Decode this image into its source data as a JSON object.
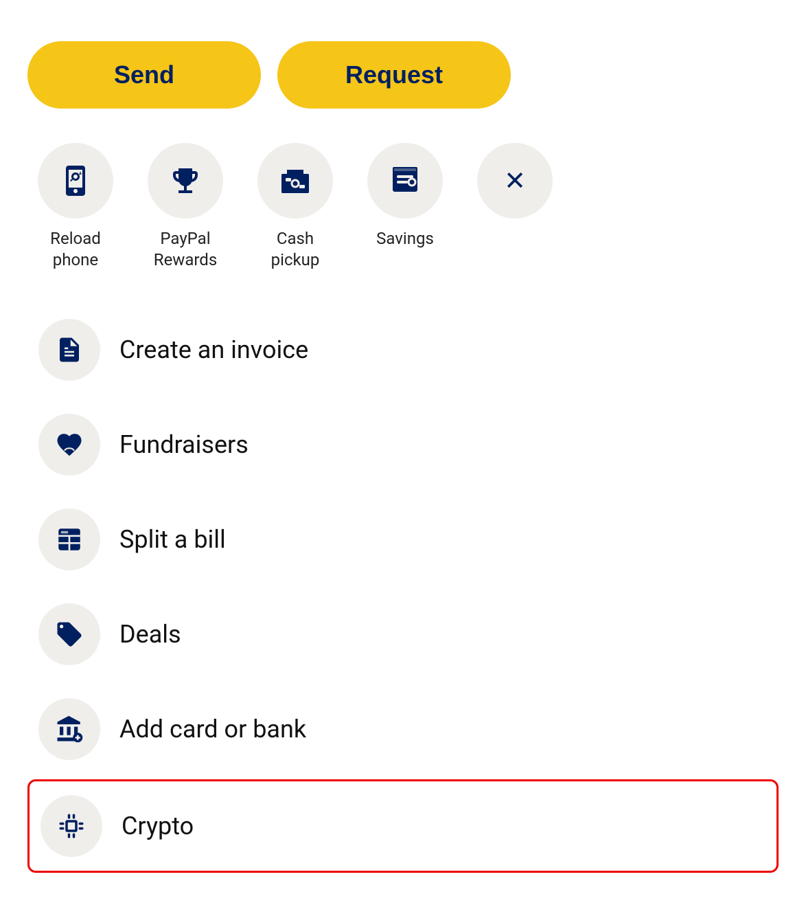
{
  "buttons": {
    "send": "Send",
    "request": "Request"
  },
  "quick_actions": [
    {
      "id": "reload-phone",
      "label": "Reload\nphone",
      "icon": "phone-reload"
    },
    {
      "id": "paypal-rewards",
      "label": "PayPal\nRewards",
      "icon": "trophy"
    },
    {
      "id": "cash-pickup",
      "label": "Cash\npickup",
      "icon": "cash-pickup"
    },
    {
      "id": "savings",
      "label": "Savings",
      "icon": "savings"
    },
    {
      "id": "close",
      "label": "",
      "icon": "close"
    }
  ],
  "list_items": [
    {
      "id": "create-invoice",
      "label": "Create an invoice",
      "icon": "invoice",
      "highlighted": false
    },
    {
      "id": "fundraisers",
      "label": "Fundraisers",
      "icon": "fundraiser",
      "highlighted": false
    },
    {
      "id": "split-bill",
      "label": "Split a bill",
      "icon": "split-bill",
      "highlighted": false
    },
    {
      "id": "deals",
      "label": "Deals",
      "icon": "deals",
      "highlighted": false
    },
    {
      "id": "add-card-bank",
      "label": "Add card or bank",
      "icon": "add-card",
      "highlighted": false
    },
    {
      "id": "crypto",
      "label": "Crypto",
      "icon": "crypto",
      "highlighted": true
    }
  ]
}
